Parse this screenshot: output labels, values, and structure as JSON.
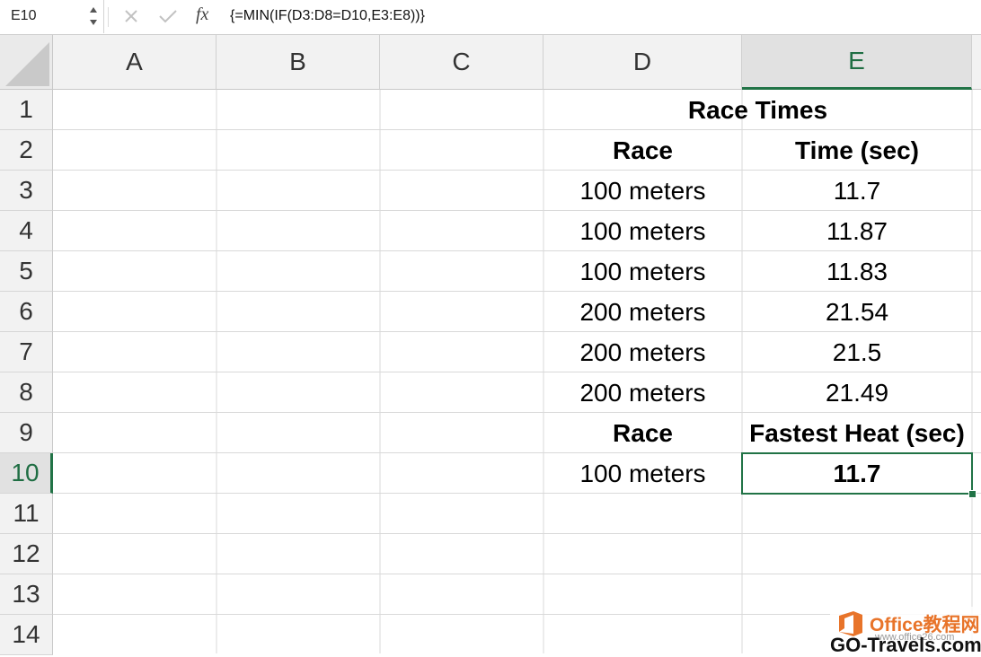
{
  "formula_bar": {
    "name_box": "E10",
    "cancel_icon": "x-icon",
    "enter_icon": "check-icon",
    "function_label": "fx",
    "formula": "{=MIN(IF(D3:D8=D10,E3:E8))}"
  },
  "columns": [
    "A",
    "B",
    "C",
    "D",
    "E"
  ],
  "selected_column": "E",
  "rows": [
    "1",
    "2",
    "3",
    "4",
    "5",
    "6",
    "7",
    "8",
    "9",
    "10",
    "11",
    "12",
    "13",
    "14"
  ],
  "selected_row": "10",
  "sheet": {
    "title": "Race Times",
    "header": {
      "race": "Race",
      "time": "Time (sec)"
    },
    "data": [
      {
        "race": "100 meters",
        "time": "11.7"
      },
      {
        "race": "100 meters",
        "time": "11.87"
      },
      {
        "race": "100 meters",
        "time": "11.83"
      },
      {
        "race": "200 meters",
        "time": "21.54"
      },
      {
        "race": "200 meters",
        "time": "21.5"
      },
      {
        "race": "200 meters",
        "time": "21.49"
      }
    ],
    "lookup_header": {
      "race": "Race",
      "result": "Fastest Heat (sec)"
    },
    "lookup": {
      "race": "100 meters",
      "result": "11.7"
    }
  },
  "active_cell": "E10",
  "accent_color": "#217346",
  "watermark": {
    "title": "Office教程网",
    "url": "www.office26.com",
    "site": "GO-Travels.com"
  }
}
